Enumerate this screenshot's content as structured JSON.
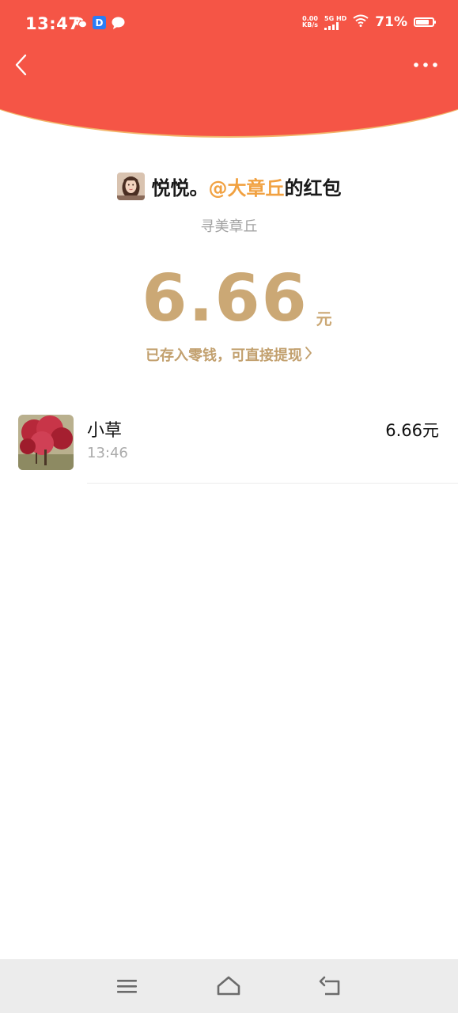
{
  "status_bar": {
    "time": "13:47",
    "net_speed_value": "0.00",
    "net_speed_unit": "KB/s",
    "network_label": "5G HD",
    "battery_percent": "71%",
    "battery_level": 0.71,
    "icons": [
      "wechat-icon",
      "dingtalk-icon",
      "message-icon",
      "signal-icon",
      "wifi-icon",
      "battery-icon"
    ]
  },
  "nav": {
    "back_icon": "chevron-left-icon",
    "more_icon": "more-dots-icon"
  },
  "packet": {
    "sender_name": "悦悦。",
    "sender_mention": "@大章丘",
    "sender_suffix": "的红包",
    "subtitle": "寻美章丘",
    "amount": "6.66",
    "amount_unit": "元",
    "saved_link_text": "已存入零钱，可直接提现"
  },
  "receivers": [
    {
      "name": "小草",
      "time": "13:46",
      "amount": "6.66元"
    }
  ],
  "bottom_nav": {
    "icons": [
      "menu-icon",
      "home-icon",
      "back-nav-icon"
    ]
  },
  "colors": {
    "header_red": "#F55546",
    "header_border": "#F2B56A",
    "amount_gold": "#CBA875",
    "mention_orange": "#F1A141"
  }
}
